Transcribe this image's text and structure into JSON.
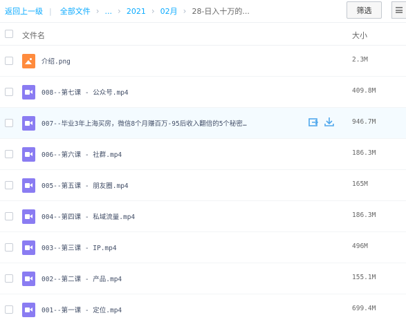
{
  "breadcrumb": {
    "back": "返回上一级",
    "separator": "|",
    "all_files": "全部文件",
    "ellipsis": "...",
    "year": "2021",
    "month": "02月",
    "current": "28-日入十万的..."
  },
  "toolbar": {
    "filter_label": "筛选",
    "menu_icon": "list-menu-icon"
  },
  "header": {
    "name_col": "文件名",
    "size_col": "大小"
  },
  "colors": {
    "link": "#09aaff",
    "video_icon": "#8a7cf2",
    "image_icon": "#ff8b3d",
    "hover_row": "#f4fbff",
    "action_icon": "#4fa7ec"
  },
  "files": [
    {
      "name": "介绍.png",
      "size": "2.3M",
      "type": "image"
    },
    {
      "name": "008--第七课 - 公众号.mp4",
      "size": "409.8M",
      "type": "video"
    },
    {
      "name": "007--毕业3年上海买房，微信8个月赚百万-95后收入翻倍的5个秘密…",
      "size": "946.7M",
      "type": "video",
      "hover": true
    },
    {
      "name": "006--第六课 - 社群.mp4",
      "size": "186.3M",
      "type": "video"
    },
    {
      "name": "005--第五课 - 朋友圈.mp4",
      "size": "165M",
      "type": "video"
    },
    {
      "name": "004--第四课 - 私域流量.mp4",
      "size": "186.3M",
      "type": "video"
    },
    {
      "name": "003--第三课 - IP.mp4",
      "size": "496M",
      "type": "video"
    },
    {
      "name": "002--第二课 - 产品.mp4",
      "size": "155.1M",
      "type": "video"
    },
    {
      "name": "001--第一课 - 定位.mp4",
      "size": "699.4M",
      "type": "video"
    }
  ]
}
